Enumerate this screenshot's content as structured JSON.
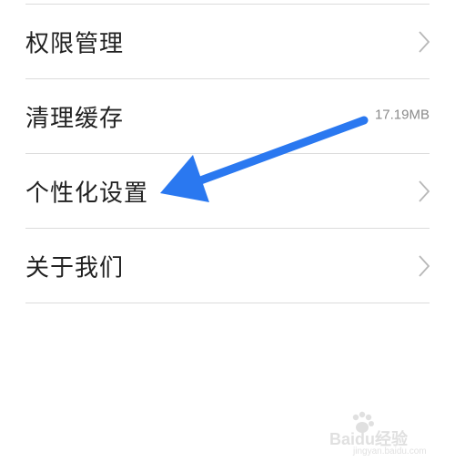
{
  "settings_list": {
    "items": [
      {
        "label": "权限管理",
        "has_chevron": true
      },
      {
        "label": "清理缓存",
        "value": "17.19MB"
      },
      {
        "label": "个性化设置",
        "has_chevron": true
      },
      {
        "label": "关于我们",
        "has_chevron": true
      }
    ]
  },
  "icons": {
    "chevron": "chevron-right-icon",
    "annotation": "arrow-icon"
  },
  "colors": {
    "arrow": "#2a78f0",
    "text": "#222222",
    "secondary_text": "#8a8a8a",
    "divider": "#dcdcdc"
  },
  "watermark": {
    "logo_text": "Baidu经验",
    "url_text": "jingyan.baidu.com"
  }
}
